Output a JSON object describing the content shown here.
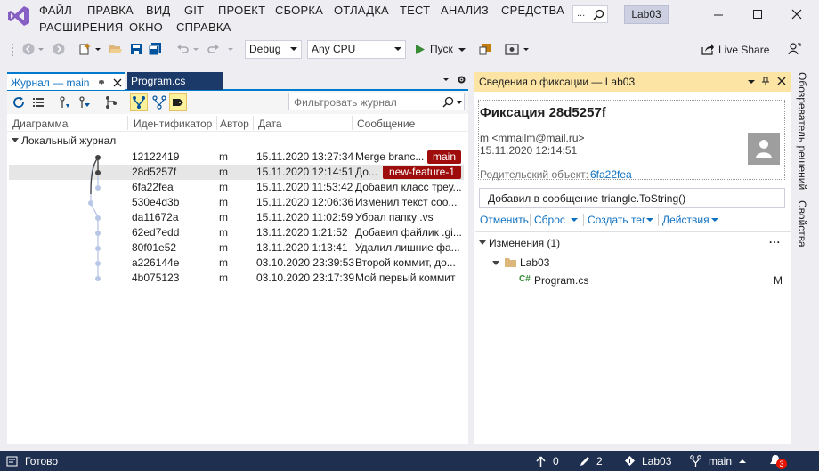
{
  "menu": {
    "items": [
      "ФАЙЛ",
      "ПРАВКА",
      "ВИД",
      "GIT",
      "ПРОЕКТ",
      "СБОРКА",
      "ОТЛАДКА",
      "ТЕСТ",
      "АНАЛИЗ",
      "СРЕДСТВА",
      "РАСШИРЕНИЯ",
      "ОКНО",
      "СПРАВКА"
    ],
    "solution_name": "Lab03"
  },
  "toolbar": {
    "config": "Debug",
    "platform": "Any CPU",
    "run_label": "Пуск",
    "live_share": "Live Share"
  },
  "left_panel": {
    "tab_active": "Журнал — main",
    "tab_other": "Program.cs",
    "filter_placeholder": "Фильтровать журнал",
    "columns": [
      "Диаграмма",
      "Идентификатор",
      "Автор",
      "Дата",
      "Сообщение"
    ],
    "group": "Локальный журнал",
    "rows": [
      {
        "id": "12122419",
        "author": "m",
        "date": "15.11.2020 13:27:34",
        "message": "Merge branc...",
        "tag": "main"
      },
      {
        "id": "28d5257f",
        "author": "m",
        "date": "15.11.2020 12:14:51",
        "message": "До...",
        "tag": "new-feature-1"
      },
      {
        "id": "6fa22fea",
        "author": "m",
        "date": "15.11.2020 11:53:42",
        "message": "Добавил класс треу...",
        "tag": ""
      },
      {
        "id": "530e4d3b",
        "author": "m",
        "date": "15.11.2020 12:06:36",
        "message": "Изменил текст соо...",
        "tag": ""
      },
      {
        "id": "da11672a",
        "author": "m",
        "date": "15.11.2020 11:02:59",
        "message": "Убрал папку .vs",
        "tag": ""
      },
      {
        "id": "62ed7edd",
        "author": "m",
        "date": "13.11.2020 1:21:52",
        "message": "Добавил файлик .gi...",
        "tag": ""
      },
      {
        "id": "80f01e52",
        "author": "m",
        "date": "13.11.2020 1:13:41",
        "message": "Удалил лишние фа...",
        "tag": ""
      },
      {
        "id": "a226144e",
        "author": "m",
        "date": "03.10.2020 23:39:53",
        "message": "Второй коммит, до...",
        "tag": ""
      },
      {
        "id": "4b075123",
        "author": "m",
        "date": "03.10.2020 23:17:39",
        "message": "Мой первый коммит",
        "tag": ""
      }
    ]
  },
  "right_panel": {
    "title": "Сведения о фиксации — Lab03",
    "commit_heading": "Фиксация 28d5257f",
    "author_line": "m <mmailm@mail.ru>",
    "date": "15.11.2020 12:14:51",
    "parent_label": "Родительский объект:",
    "parent_id": "6fa22fea",
    "message": "Добавил в сообщение triangle.ToString()",
    "actions": [
      "Отменить",
      "Сброс",
      "Создать тег",
      "Действия"
    ],
    "changes_header": "Изменения (1)",
    "folder": "Lab03",
    "file": "Program.cs",
    "file_status": "M"
  },
  "side_rail": [
    "Обозреватель решений",
    "Свойства"
  ],
  "status": {
    "ready": "Готово",
    "up_count": "0",
    "edit_count": "2",
    "repo": "Lab03",
    "branch": "main",
    "notifications": "3"
  },
  "colors": {
    "accent": "#68217a",
    "tag": "#9e0c0c",
    "status_bg": "#1e2f4f",
    "active_pane_header": "#fce4a4"
  }
}
